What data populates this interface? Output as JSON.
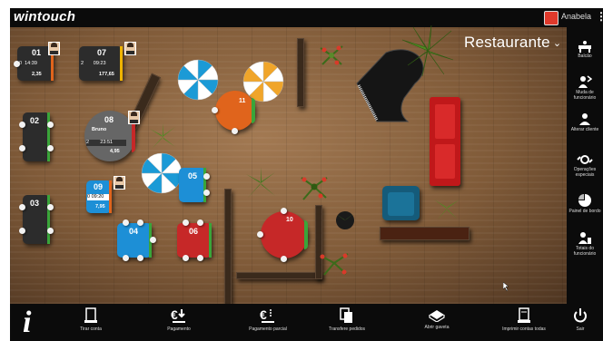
{
  "app": {
    "logo": "wintouch",
    "user_name": "Anabela",
    "menu_glyph": "⋮"
  },
  "room": {
    "name": "Restaurante",
    "chevron": "⌄"
  },
  "sidebar": {
    "items": [
      {
        "label": "Balcão",
        "icon": "counter-icon"
      },
      {
        "label": "Muda de funcionário",
        "icon": "change-employee-icon"
      },
      {
        "label": "Alterar cliente",
        "icon": "change-client-icon"
      },
      {
        "label": "Operações especiais",
        "icon": "special-operations-icon"
      },
      {
        "label": "Painel de bordo",
        "icon": "dashboard-icon"
      },
      {
        "label": "Totais do funcionário",
        "icon": "employee-totals-icon"
      }
    ]
  },
  "bottombar": {
    "info_glyph": "i",
    "items": [
      {
        "label": "Tirar conta",
        "icon": "receipt-icon"
      },
      {
        "label": "Pagamento",
        "icon": "payment-icon"
      },
      {
        "label": "Pagamento parcial",
        "icon": "partial-payment-icon"
      },
      {
        "label": "Transfere pedidos",
        "icon": "transfer-orders-icon"
      },
      {
        "label": "Abrir gaveta",
        "icon": "open-drawer-icon"
      },
      {
        "label": "Imprimir contas todas",
        "icon": "print-all-icon"
      }
    ],
    "exit_label": "Sair"
  },
  "tables": {
    "t01": {
      "number": "01",
      "count": "0",
      "time": "14:39",
      "amount": "2,35"
    },
    "t07": {
      "number": "07",
      "count": "2",
      "time": "09:23",
      "amount": "177,65"
    },
    "t02": {
      "number": "02"
    },
    "t08": {
      "number": "08",
      "waiter": "Bruno",
      "count": "2",
      "time": "23:51",
      "amount": "4,95"
    },
    "t03": {
      "number": "03"
    },
    "t09": {
      "number": "09",
      "count": "0",
      "time": "09:20",
      "amount": "7,95"
    },
    "t04": {
      "number": "04"
    },
    "t05": {
      "number": "05"
    },
    "t06": {
      "number": "06"
    },
    "t10": {
      "number": "10"
    },
    "t11": {
      "number": "11"
    }
  },
  "colors": {
    "occupied_dark": "#2c2c2c",
    "free_blue": "#1d8fd6",
    "red": "#c62828",
    "orange": "#e0641c",
    "green_stripe": "#3aa53a",
    "sofa_red": "#c0181a",
    "chair_teal": "#155b7a"
  }
}
